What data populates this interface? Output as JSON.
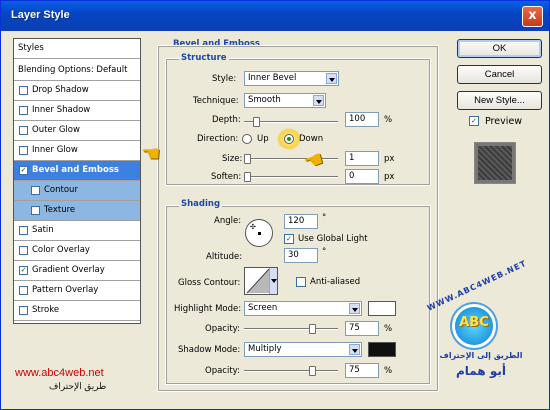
{
  "window": {
    "title": "Layer Style",
    "close_label": "x"
  },
  "styles_list": {
    "header": "Styles",
    "blending": "Blending Options: Default",
    "items": [
      {
        "label": "Drop Shadow",
        "checked": false
      },
      {
        "label": "Inner Shadow",
        "checked": false
      },
      {
        "label": "Outer Glow",
        "checked": false
      },
      {
        "label": "Inner Glow",
        "checked": false
      },
      {
        "label": "Bevel and Emboss",
        "checked": true
      },
      {
        "label": "Contour",
        "checked": false
      },
      {
        "label": "Texture",
        "checked": false
      },
      {
        "label": "Satin",
        "checked": false
      },
      {
        "label": "Color Overlay",
        "checked": false
      },
      {
        "label": "Gradient Overlay",
        "checked": true
      },
      {
        "label": "Pattern Overlay",
        "checked": false
      },
      {
        "label": "Stroke",
        "checked": false
      }
    ],
    "check_glyph": "✓"
  },
  "bevel": {
    "title": "Bevel and Emboss",
    "structure": {
      "title": "Structure",
      "style_label": "Style:",
      "style_value": "Inner Bevel",
      "technique_label": "Technique:",
      "technique_value": "Smooth",
      "depth_label": "Depth:",
      "depth_value": "100",
      "depth_unit": "%",
      "depth_level": 0.1,
      "direction_label": "Direction:",
      "dir_up": "Up",
      "dir_down": "Down",
      "direction": "Down",
      "size_label": "Size:",
      "size_value": "1",
      "size_unit": "px",
      "size_level": 0.0,
      "soften_label": "Soften:",
      "soften_value": "0",
      "soften_unit": "px",
      "soften_level": 0.0
    },
    "shading": {
      "title": "Shading",
      "angle_label": "Angle:",
      "angle_value": "120",
      "angle_unit": "°",
      "global_light_label": "Use Global Light",
      "global_light": true,
      "altitude_label": "Altitude:",
      "altitude_value": "30",
      "altitude_unit": "°",
      "gloss_label": "Gloss Contour:",
      "anti_aliased_label": "Anti-aliased",
      "highlight_label": "Highlight Mode:",
      "highlight_value": "Screen",
      "highlight_color": "#ffffff",
      "h_opacity_label": "Opacity:",
      "h_opacity_value": "75",
      "h_opacity_unit": "%",
      "h_opacity_level": 0.75,
      "shadow_label": "Shadow Mode:",
      "shadow_value": "Multiply",
      "shadow_color": "#101010",
      "s_opacity_label": "Opacity:",
      "s_opacity_value": "75",
      "s_opacity_unit": "%",
      "s_opacity_level": 0.75
    }
  },
  "buttons": {
    "ok": "OK",
    "cancel": "Cancel",
    "new_style": "New Style...",
    "preview": "Preview",
    "preview_checked": true
  },
  "watermark": {
    "url": "www.abc4web.net",
    "arabic": "طريق الإحتراف",
    "logo_top": "WWW.ABC4WEB.NET",
    "logo_letters": "ABC",
    "logo_arabic": "الطريق إلى الإحتراف",
    "logo_name": "أبو همام"
  }
}
